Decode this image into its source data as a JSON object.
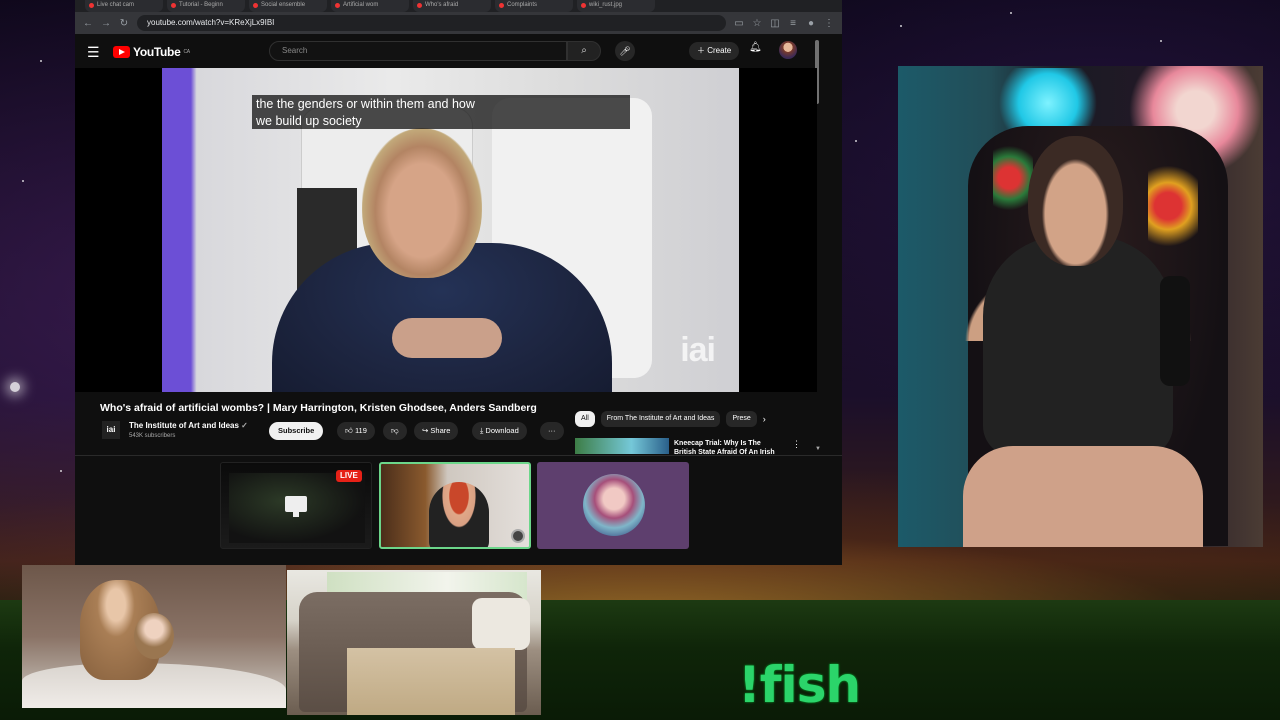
{
  "browser": {
    "tabs": [
      "Live chat cam",
      "Tutorial - Beginn",
      "Social ensemble",
      "Artificial wom",
      "Who's afraid",
      "Complaints",
      "wiki_rust.jpg"
    ],
    "url": "youtube.com/watch?v=KReXjLx9IBI"
  },
  "youtube": {
    "logo_text": "YouTube",
    "logo_country": "CA",
    "search_placeholder": "Search",
    "create_label": "Create",
    "caption_text": "the the genders or within them and how\nwe build up society",
    "watermark": "iai",
    "video_title": "Who's afraid of artificial wombs? | Mary Harrington, Kristen Ghodsee, Anders Sandberg",
    "channel_logo": "iai",
    "channel_name": "The Institute of Art and Ideas",
    "channel_subscribers": "543K subscribers",
    "subscribe_label": "Subscribe",
    "like_count": "119",
    "share_label": "Share",
    "download_label": "Download",
    "more_label": "···",
    "chips": [
      "All",
      "From The Institute of Art and Ideas",
      "Prese"
    ],
    "recommended_title": "Kneecap Trial: Why Is The\nBritish State Afraid Of An Irish"
  },
  "stream": {
    "live_badge": "LIVE",
    "overlay_command": "!fish"
  }
}
